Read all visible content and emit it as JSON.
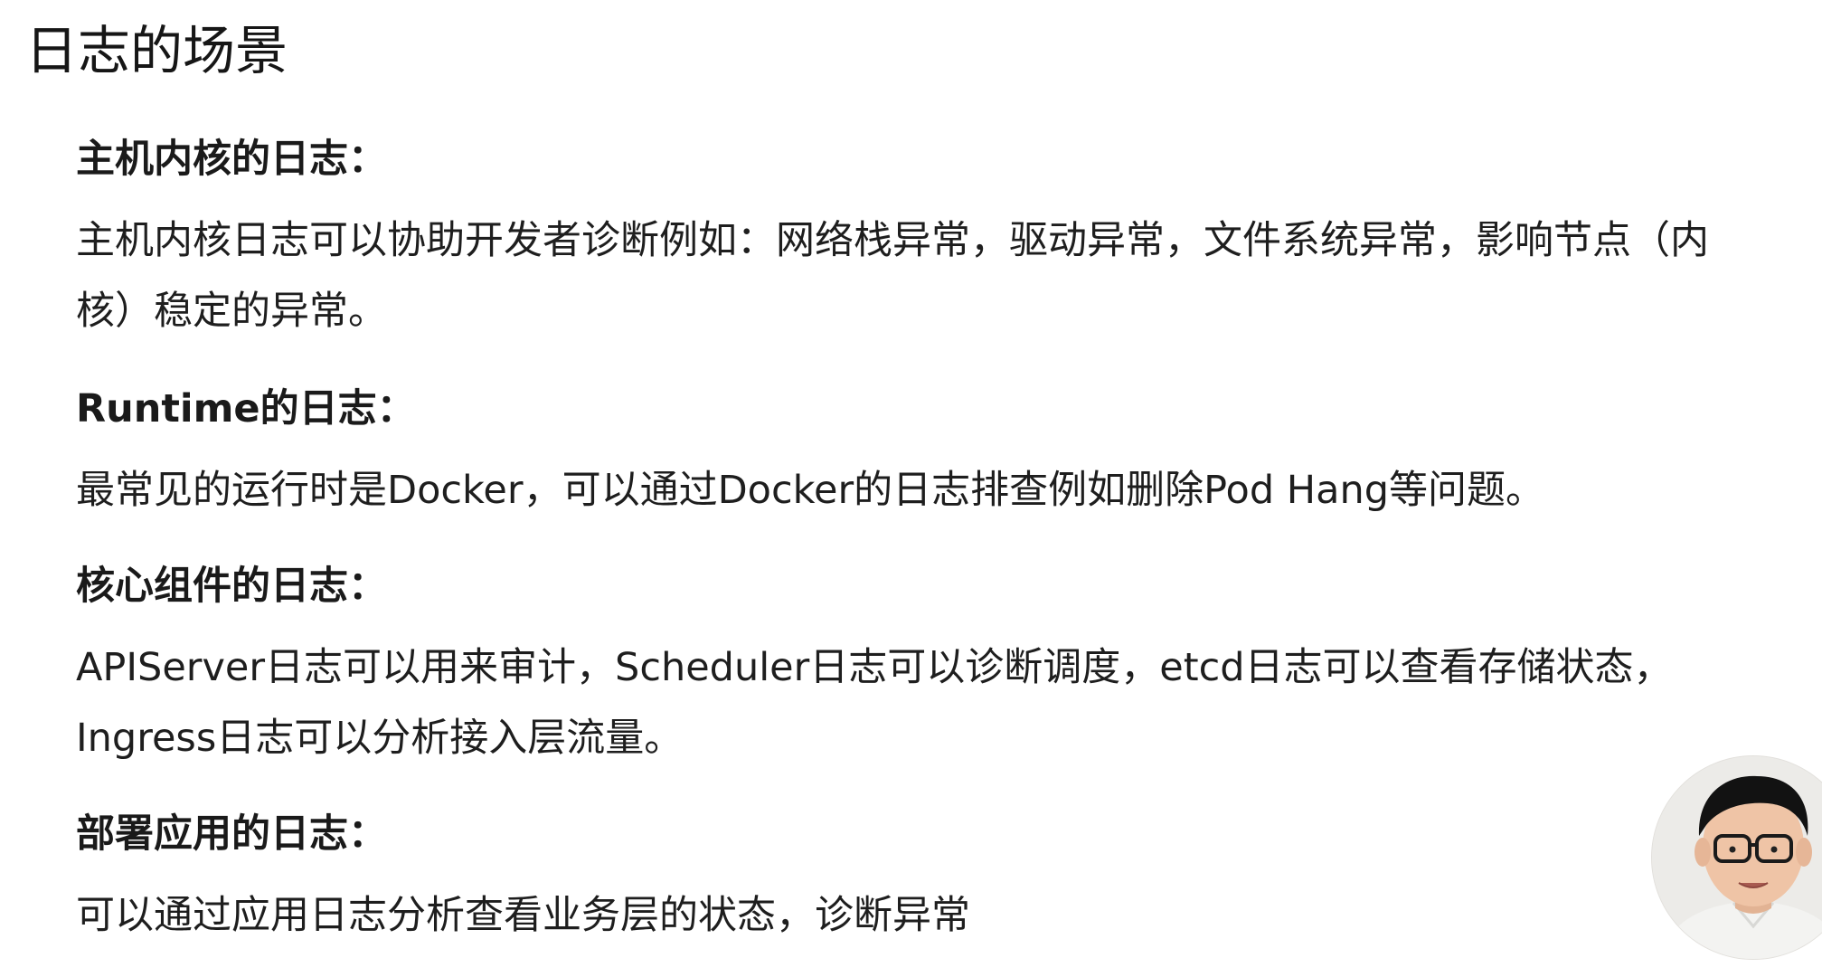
{
  "title": "日志的场景",
  "sections": [
    {
      "heading": "主机内核的日志：",
      "lines": [
        "主机内核日志可以协助开发者诊断例如：网络栈异常，驱动异常，文件系统异常，影响节点（内",
        "核）稳定的异常。"
      ]
    },
    {
      "heading": "Runtime的日志：",
      "lines": [
        "最常见的运行时是Docker，可以通过Docker的日志排查例如删除Pod Hang等问题。"
      ]
    },
    {
      "heading": "核心组件的日志：",
      "lines": [
        "APIServer日志可以用来审计，Scheduler日志可以诊断调度，etcd日志可以查看存储状态，",
        "Ingress日志可以分析接入层流量。"
      ]
    },
    {
      "heading": "部署应用的日志：",
      "lines": [
        "可以通过应用日志分析查看业务层的状态，诊断异常"
      ]
    }
  ],
  "presenter": {
    "icon": "presenter-webcam-avatar"
  },
  "colors": {
    "background": "#ffffff",
    "text": "#1c1c1c"
  }
}
